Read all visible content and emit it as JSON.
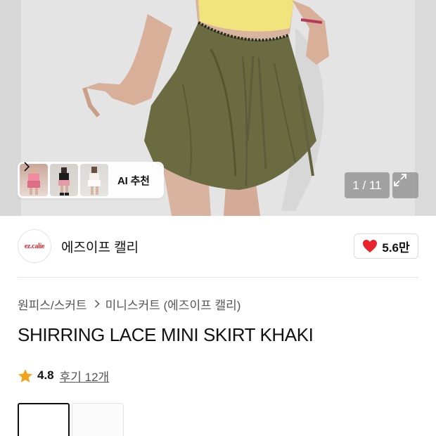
{
  "hero": {
    "ai_recommend_label": "AI 추천",
    "page_counter": "1 / 11"
  },
  "brand": {
    "logo_text": "ez.calie",
    "name": "에즈이프 캘리",
    "likes": "5.6만"
  },
  "category": {
    "primary": "원피스/스커트",
    "secondary": "미니스커트 (에즈이프 캘리)"
  },
  "product": {
    "title": "SHIRRING LACE MINI SKIRT KHAKI"
  },
  "rating": {
    "score": "4.8",
    "reviews": "후기 12개"
  },
  "colors": {
    "accent_star": "#f2a31b",
    "heart": "#e8232e",
    "skirt_khaki": "#6b6b42"
  }
}
